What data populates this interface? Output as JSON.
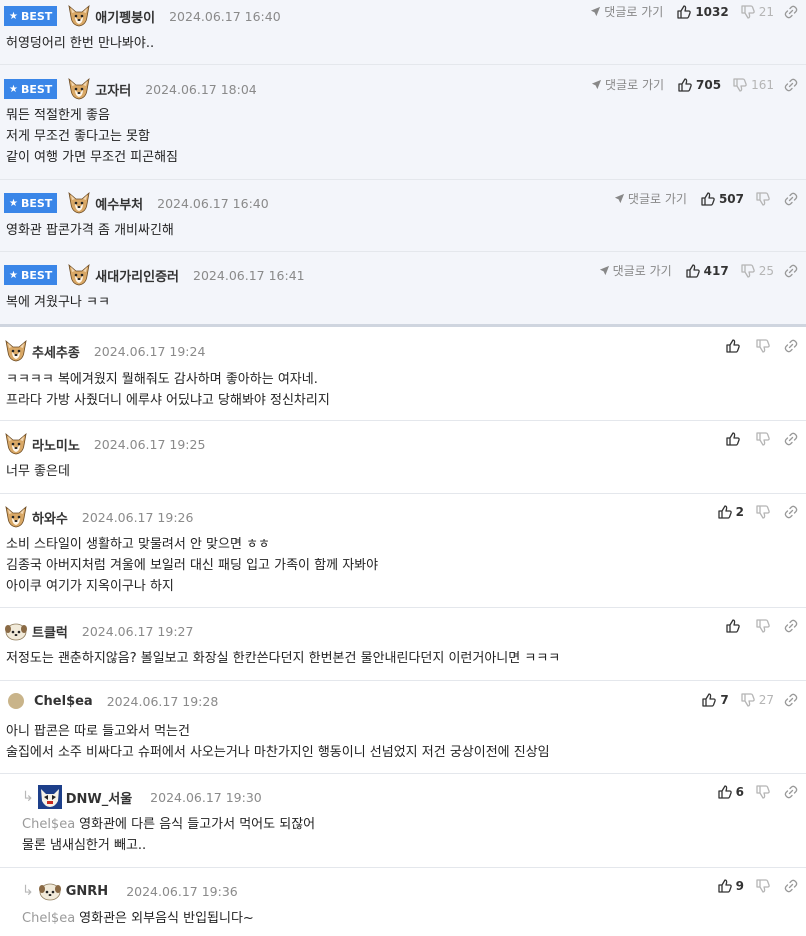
{
  "labels": {
    "best": "BEST",
    "goto": "댓글로 가기"
  },
  "best_comments": [
    {
      "nick": "애기펭붕이",
      "date": "2024.06.17 16:40",
      "likes": "1032",
      "dislikes": "21",
      "lines": [
        "허영덩어리 한번 만나봐야.."
      ]
    },
    {
      "nick": "고자터",
      "date": "2024.06.17 18:04",
      "likes": "705",
      "dislikes": "161",
      "lines": [
        "뭐든 적절한게 좋음",
        "저게 무조건 좋다고는 못함",
        "같이 여행 가면 무조건 피곤해짐"
      ]
    },
    {
      "nick": "예수부처",
      "date": "2024.06.17 16:40",
      "likes": "507",
      "dislikes": "",
      "lines": [
        "영화관 팝콘가격 좀 개비싸긴해"
      ]
    },
    {
      "nick": "새대가리인증러",
      "date": "2024.06.17 16:41",
      "likes": "417",
      "dislikes": "25",
      "lines": [
        "복에 겨웠구나 ㅋㅋ"
      ]
    }
  ],
  "comments": [
    {
      "nick": "추세추종",
      "date": "2024.06.17 19:24",
      "likes": "",
      "dislikes": "",
      "lines": [
        "ㅋㅋㅋㅋ 복에겨웠지 뭘해줘도 감사하며 좋아하는 여자네.",
        "프라다 가방 사줬더니 에루샤 어딨냐고 당해봐야 정신차리지"
      ]
    },
    {
      "nick": "라노미노",
      "date": "2024.06.17 19:25",
      "likes": "",
      "dislikes": "",
      "lines": [
        "너무 좋은데"
      ]
    },
    {
      "nick": "하와수",
      "date": "2024.06.17 19:26",
      "likes": "2",
      "dislikes": "",
      "lines": [
        "소비 스타일이 생활하고 맞물려서 안 맞으면 ㅎㅎ",
        "김종국 아버지처럼 겨울에 보일러 대신 패딩 입고 가족이 함께 자봐야",
        "아이쿠 여기가 지옥이구나 하지"
      ]
    },
    {
      "nick": "트클럭",
      "date": "2024.06.17 19:27",
      "likes": "",
      "dislikes": "",
      "lines": [
        "저정도는 괜춘하지않음? 볼일보고 화장실 한칸쓴다던지 한번본건 물안내린다던지 이런거아니면 ㅋㅋㅋ"
      ]
    },
    {
      "nick": "Chel$ea",
      "date": "2024.06.17 19:28",
      "likes": "7",
      "dislikes": "27",
      "lines": [
        "아니 팝콘은 따로 들고와서 먹는건",
        "술집에서 소주 비싸다고 슈퍼에서 사오는거나 마찬가지인 행동이니 선넘었지 저건 궁상이전에 진상임"
      ]
    },
    {
      "nick": "DNW_서울",
      "date": "2024.06.17 19:30",
      "likes": "6",
      "dislikes": "",
      "mention": "Chel$ea",
      "lines": [
        "영화관에 다른 음식 들고가서 먹어도 되잖어",
        "물론 냄새심한거 빼고.."
      ]
    },
    {
      "nick": "GNRH",
      "date": "2024.06.17 19:36",
      "likes": "9",
      "dislikes": "",
      "mention": "Chel$ea",
      "lines": [
        "영화관은 외부음식 반입됩니다~"
      ]
    }
  ]
}
